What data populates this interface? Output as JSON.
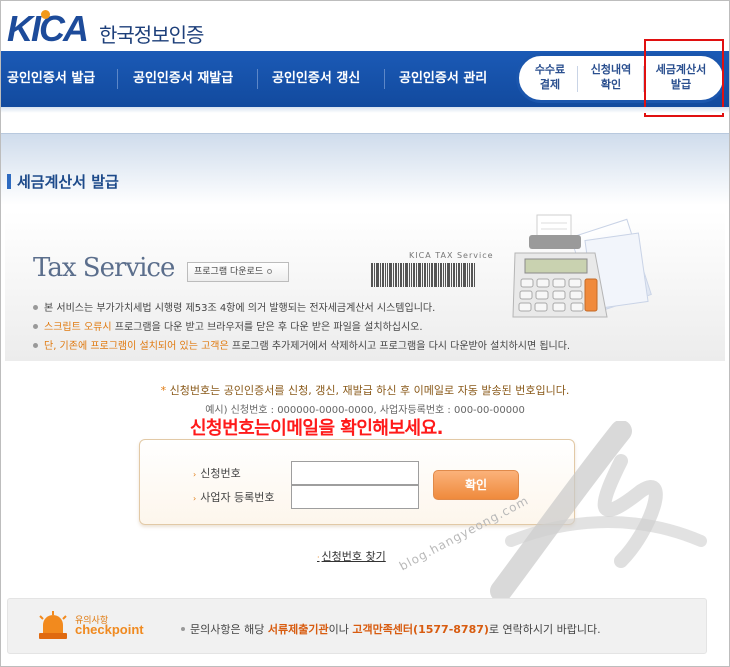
{
  "header": {
    "logo_text": "KICA",
    "logo_sub": "한국정보인증"
  },
  "nav": {
    "items": [
      {
        "label": "공인인증서 발급"
      },
      {
        "label": "공인인증서 재발급"
      },
      {
        "label": "공인인증서 갱신"
      },
      {
        "label": "공인인증서 관리"
      }
    ],
    "quick": [
      {
        "line1": "수수료",
        "line2": "결제"
      },
      {
        "line1": "신청내역",
        "line2": "확인"
      },
      {
        "line1": "세금계산서",
        "line2": "발급"
      }
    ]
  },
  "section": {
    "title": "세금계산서 발급"
  },
  "banner": {
    "tax_title": "Tax Service",
    "download_label": "프로그램 다운로드",
    "barcode_label": "KICA  TAX Service",
    "note1": "본 서비스는 부가가치세법 시행령 제53조 4항에 의거 발행되는 전자세금계산서 시스템입니다.",
    "note2_orange": "스크립트 오류시",
    "note2_rest": " 프로그램을 다운 받고 브라우저를 닫은 후 다운 받은 파일을 설치하십시오.",
    "note3_orange": "단, 기존에 프로그램이 설치되어 있는 고객은",
    "note3_rest": " 프로그램 추가제거에서 삭제하시고 프로그램을 다시 다운받아 설치하시면 됩니다."
  },
  "notice": {
    "line1_star": "*",
    "line1": " 신청번호는 공인인증서를 신청, 갱신, 재발급 하신 후 이메일로 자동 발송된 번호입니다.",
    "line2": "예시) 신청번호 : 000000-0000-0000, 사업자등록번호 : 000-00-00000",
    "red_text": "신청번호는이메일을 확인해보세요."
  },
  "form": {
    "application_number_label": "신청번호",
    "business_number_label": "사업자 등록번호",
    "application_number_value": "",
    "business_number_value": "",
    "confirm_label": "확인",
    "find_link": "신청번호 찾기"
  },
  "watermark": {
    "text": "blog.hangyeong.com"
  },
  "checkpoint": {
    "small_label": "유의사항",
    "word": "checkpoint",
    "text_pre": "문의사항은 해당 ",
    "text_org1": "서류제출기관",
    "text_mid": "이나 ",
    "text_org2": "고객만족센터(1577-8787)",
    "text_post": "로 연락하시기 바랍니다."
  },
  "colors": {
    "nav_blue": "#1b5ab6",
    "accent_orange": "#e07a10",
    "highlight_red": "#e01010",
    "notice_red": "#ff1a1a"
  }
}
